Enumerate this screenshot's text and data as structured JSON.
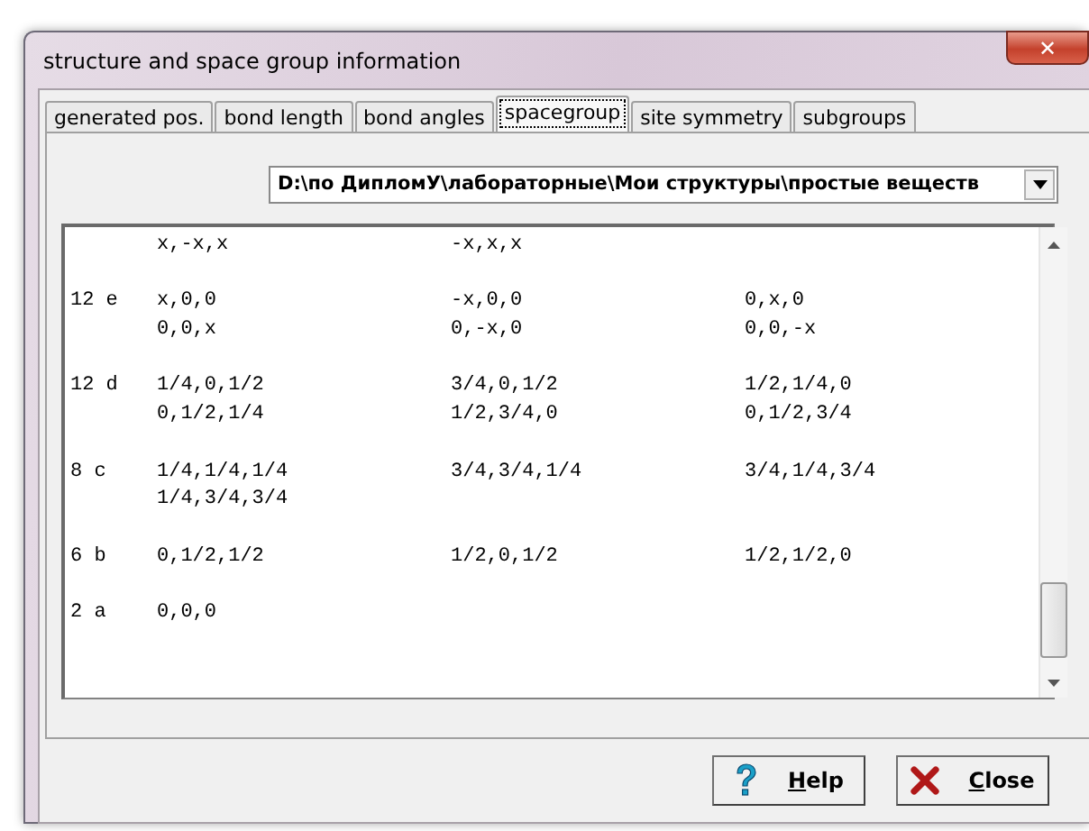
{
  "window": {
    "title": "structure and space group information",
    "close_glyph": "✕"
  },
  "tabs": [
    {
      "label": "generated pos.",
      "selected": false
    },
    {
      "label": "bond length",
      "selected": false
    },
    {
      "label": "bond angles",
      "selected": false
    },
    {
      "label": "spacegroup",
      "selected": true
    },
    {
      "label": "site symmetry",
      "selected": false
    },
    {
      "label": "subgroups",
      "selected": false
    }
  ],
  "file_combo": {
    "value": "D:\\по ДипломУ\\лабораторные\\Мои структуры\\простые веществ"
  },
  "positions": [
    {
      "lines": [
        [
          "x,-x,x",
          "-x,x,x"
        ]
      ]
    },
    {
      "site": "12 e",
      "lines": [
        [
          "x,0,0",
          "-x,0,0",
          "0,x,0"
        ],
        [
          "0,0,x",
          "0,-x,0",
          "0,0,-x"
        ]
      ]
    },
    {
      "site": "12 d",
      "lines": [
        [
          "1/4,0,1/2",
          "3/4,0,1/2",
          "1/2,1/4,0"
        ],
        [
          "0,1/2,1/4",
          "1/2,3/4,0",
          "0,1/2,3/4"
        ]
      ]
    },
    {
      "site": "8 c",
      "lines": [
        [
          "1/4,1/4,1/4",
          "3/4,3/4,1/4",
          "3/4,1/4,3/4"
        ],
        [
          "1/4,3/4,3/4"
        ]
      ]
    },
    {
      "site": "6 b",
      "lines": [
        [
          "0,1/2,1/2",
          "1/2,0,1/2",
          "1/2,1/2,0"
        ]
      ]
    },
    {
      "site": "2 a",
      "lines": [
        [
          "0,0,0"
        ]
      ]
    }
  ],
  "buttons": [
    {
      "kind": "help",
      "label": "Help"
    },
    {
      "kind": "close",
      "label": "Close"
    }
  ]
}
